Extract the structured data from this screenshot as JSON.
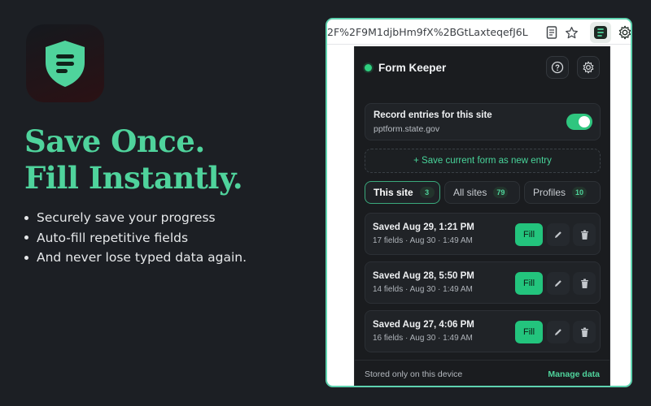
{
  "hero": {
    "app_icon": "shield-form-icon",
    "headline_line1": "Save Once.",
    "headline_line2": "Fill Instantly.",
    "bullets": [
      "Securely save your progress",
      "Auto-fill repetitive fields",
      "And never lose typed data again."
    ],
    "accent_color": "#4fd39c"
  },
  "browser": {
    "url": "2F%2F9M1djbHm9fX%2BGtLaxteqefJ6LX...",
    "toolbar_icons": [
      "reader-mode-icon",
      "bookmark-star-icon",
      "form-keeper-extension-icon",
      "settings-gear-icon"
    ]
  },
  "popup": {
    "title": "Form Keeper",
    "status": "active",
    "header_icons": [
      "help-icon",
      "settings-gear-icon"
    ],
    "record": {
      "label": "Record entries for this site",
      "domain": "pptform.state.gov",
      "enabled": true
    },
    "save_entry_label": "+ Save current form as new entry",
    "tabs": [
      {
        "label": "This site",
        "count": "3",
        "active": true
      },
      {
        "label": "All sites",
        "count": "79",
        "active": false
      },
      {
        "label": "Profiles",
        "count": "10",
        "active": false
      }
    ],
    "entries": [
      {
        "title": "Saved Aug 29, 1:21 PM",
        "meta": "17 fields · Aug 30 · 1:49 AM",
        "fill_label": "Fill"
      },
      {
        "title": "Saved Aug 28, 5:50 PM",
        "meta": "14 fields · Aug 30 · 1:49 AM",
        "fill_label": "Fill"
      },
      {
        "title": "Saved Aug 27, 4:06 PM",
        "meta": "16 fields · Aug 30 · 1:49 AM",
        "fill_label": "Fill"
      }
    ],
    "footer": {
      "note": "Stored only on this device",
      "link": "Manage data"
    },
    "colors": {
      "accent": "#23c47d",
      "background": "#1a1c1f"
    }
  }
}
